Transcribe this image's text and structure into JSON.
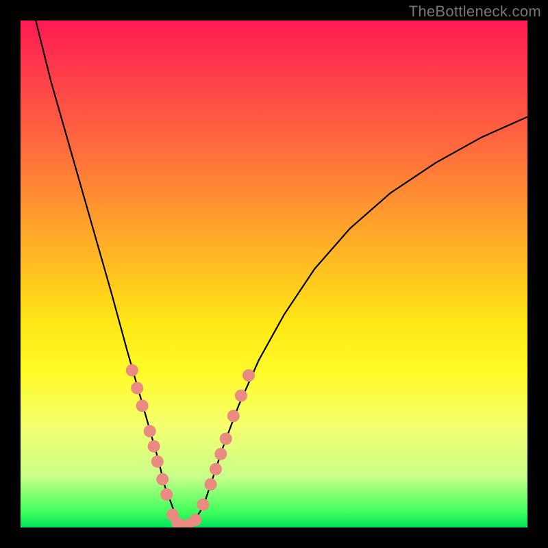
{
  "watermark": "TheBottleneck.com",
  "chart_data": {
    "type": "line",
    "title": "",
    "xlabel": "",
    "ylabel": "",
    "xlim": [
      0,
      100
    ],
    "ylim": [
      0,
      100
    ],
    "series": [
      {
        "name": "curve",
        "x": [
          3,
          6,
          10,
          14,
          18,
          21,
          23,
          25,
          27,
          28.5,
          30,
          31,
          32,
          33,
          34,
          36,
          38,
          40,
          43,
          47,
          52,
          58,
          65,
          73,
          82,
          91,
          100
        ],
        "y": [
          100,
          88,
          74,
          60,
          46,
          35,
          28,
          21,
          14,
          8,
          4,
          1,
          0,
          0,
          1,
          4,
          10,
          16,
          24,
          33,
          42,
          51,
          59,
          66,
          72,
          77,
          81
        ]
      }
    ],
    "markers": [
      {
        "x": 22.0,
        "y": 31.0
      },
      {
        "x": 23.0,
        "y": 27.5
      },
      {
        "x": 24.0,
        "y": 24.0
      },
      {
        "x": 25.5,
        "y": 19.0
      },
      {
        "x": 26.3,
        "y": 16.0
      },
      {
        "x": 27.0,
        "y": 13.0
      },
      {
        "x": 28.0,
        "y": 9.5
      },
      {
        "x": 28.8,
        "y": 6.5
      },
      {
        "x": 30.0,
        "y": 2.5
      },
      {
        "x": 31.0,
        "y": 0.8
      },
      {
        "x": 33.0,
        "y": 0.5
      },
      {
        "x": 34.5,
        "y": 1.5
      },
      {
        "x": 36.0,
        "y": 4.5
      },
      {
        "x": 37.5,
        "y": 8.5
      },
      {
        "x": 38.5,
        "y": 11.5
      },
      {
        "x": 39.5,
        "y": 14.5
      },
      {
        "x": 40.5,
        "y": 17.5
      },
      {
        "x": 42.0,
        "y": 22.0
      },
      {
        "x": 43.5,
        "y": 26.0
      },
      {
        "x": 45.0,
        "y": 30.0
      }
    ],
    "marker_style": {
      "fill": "#e98b80",
      "r": 9
    }
  }
}
